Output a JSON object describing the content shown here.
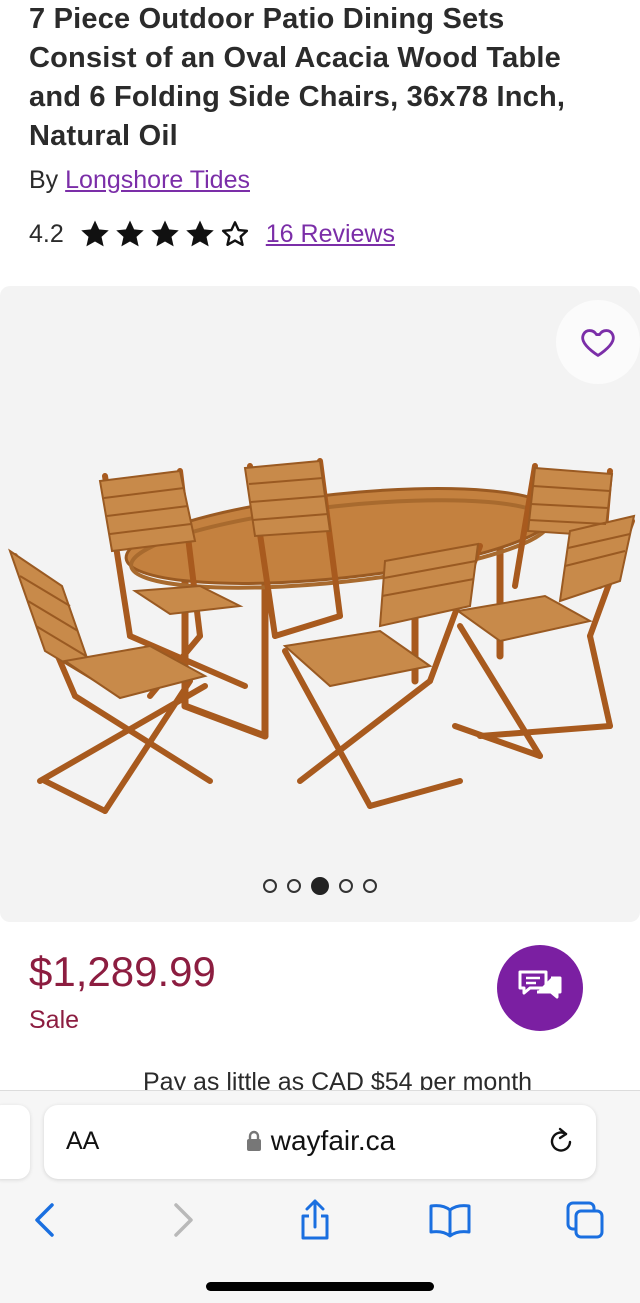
{
  "product": {
    "title": "7 Piece Outdoor Patio Dining Sets Consist of an Oval Acacia Wood Table and 6 Folding Side Chairs, 36x78 Inch, Natural Oil",
    "by_prefix": "By",
    "brand": "Longshore Tides",
    "rating": "4.2",
    "rating_value": 4.2,
    "rating_max": 5,
    "reviews": "16 Reviews",
    "price": "$1,289.99",
    "price_status": "Sale",
    "financing": "Pay as little as CAD $54 per month"
  },
  "gallery": {
    "image_count": 5,
    "active_index": 2,
    "favorite_icon": "heart-icon"
  },
  "browser": {
    "text_size_label": "AA",
    "url": "wayfair.ca",
    "icons": [
      "lock-icon",
      "reload-icon",
      "back-icon",
      "forward-icon",
      "share-icon",
      "bookmarks-icon",
      "tabs-icon"
    ]
  },
  "colors": {
    "accent_purple": "#7b2ea8",
    "price_red": "#8c1d40",
    "chat_purple": "#7b1fa2"
  }
}
